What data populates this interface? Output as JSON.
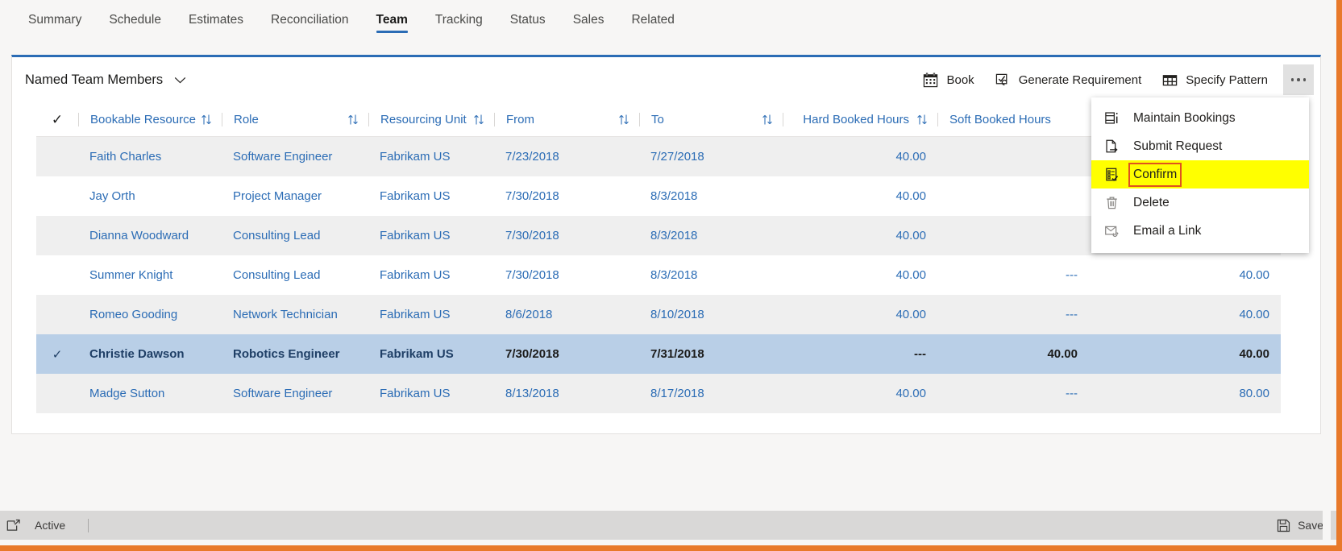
{
  "tabs": [
    {
      "label": "Summary",
      "active": false
    },
    {
      "label": "Schedule",
      "active": false
    },
    {
      "label": "Estimates",
      "active": false
    },
    {
      "label": "Reconciliation",
      "active": false
    },
    {
      "label": "Team",
      "active": true
    },
    {
      "label": "Tracking",
      "active": false
    },
    {
      "label": "Status",
      "active": false
    },
    {
      "label": "Sales",
      "active": false
    },
    {
      "label": "Related",
      "active": false
    }
  ],
  "grid": {
    "view_name": "Named Team Members",
    "toolbar": [
      {
        "label": "Book",
        "icon": "calendar-icon"
      },
      {
        "label": "Generate Requirement",
        "icon": "checkbox-refresh-icon"
      },
      {
        "label": "Specify Pattern",
        "icon": "table-grid-icon"
      }
    ],
    "overflow_label": "...",
    "columns": [
      {
        "label": "Bookable Resource",
        "sortable": true,
        "align": "left"
      },
      {
        "label": "Role",
        "sortable": true,
        "align": "left"
      },
      {
        "label": "Resourcing Unit",
        "sortable": true,
        "align": "left"
      },
      {
        "label": "From",
        "sortable": true,
        "align": "left"
      },
      {
        "label": "To",
        "sortable": true,
        "align": "left"
      },
      {
        "label": "Hard Booked Hours",
        "sortable": true,
        "align": "right"
      },
      {
        "label": "Soft Booked Hours",
        "sortable": true,
        "align": "right"
      },
      {
        "label": "",
        "sortable": false,
        "align": "right"
      }
    ],
    "rows": [
      {
        "selected": false,
        "resource": "Faith Charles",
        "role": "Software Engineer",
        "unit": "Fabrikam US",
        "from": "7/23/2018",
        "to": "7/27/2018",
        "hard": "40.00",
        "soft": "",
        "total": ""
      },
      {
        "selected": false,
        "resource": "Jay Orth",
        "role": "Project Manager",
        "unit": "Fabrikam US",
        "from": "7/30/2018",
        "to": "8/3/2018",
        "hard": "40.00",
        "soft": "",
        "total": ""
      },
      {
        "selected": false,
        "resource": "Dianna Woodward",
        "role": "Consulting Lead",
        "unit": "Fabrikam US",
        "from": "7/30/2018",
        "to": "8/3/2018",
        "hard": "40.00",
        "soft": "",
        "total": ""
      },
      {
        "selected": false,
        "resource": "Summer Knight",
        "role": "Consulting Lead",
        "unit": "Fabrikam US",
        "from": "7/30/2018",
        "to": "8/3/2018",
        "hard": "40.00",
        "soft": "---",
        "total": "40.00"
      },
      {
        "selected": false,
        "resource": "Romeo Gooding",
        "role": "Network Technician",
        "unit": "Fabrikam US",
        "from": "8/6/2018",
        "to": "8/10/2018",
        "hard": "40.00",
        "soft": "---",
        "total": "40.00"
      },
      {
        "selected": true,
        "resource": "Christie Dawson",
        "role": "Robotics Engineer",
        "unit": "Fabrikam US",
        "from": "7/30/2018",
        "to": "7/31/2018",
        "hard": "---",
        "soft": "40.00",
        "total": "40.00"
      },
      {
        "selected": false,
        "resource": "Madge Sutton",
        "role": "Software Engineer",
        "unit": "Fabrikam US",
        "from": "8/13/2018",
        "to": "8/17/2018",
        "hard": "40.00",
        "soft": "---",
        "total": "80.00"
      }
    ]
  },
  "context_menu": {
    "items": [
      {
        "label": "Maintain Bookings",
        "icon": "maintain-bookings-icon",
        "highlighted": false
      },
      {
        "label": "Submit Request",
        "icon": "submit-request-icon",
        "highlighted": false
      },
      {
        "label": "Confirm",
        "icon": "confirm-checklist-icon",
        "highlighted": true
      },
      {
        "label": "Delete",
        "icon": "trash-icon",
        "highlighted": false
      },
      {
        "label": "Email a Link",
        "icon": "email-link-icon",
        "highlighted": false
      }
    ]
  },
  "footer": {
    "status": "Active",
    "save_label": "Save"
  },
  "colors": {
    "accent_blue": "#2b6cb5",
    "selected_row": "#b9cfe7",
    "highlight_yellow": "#ffff00",
    "annotation_orange": "#e0521f",
    "window_border": "#e8792a"
  }
}
